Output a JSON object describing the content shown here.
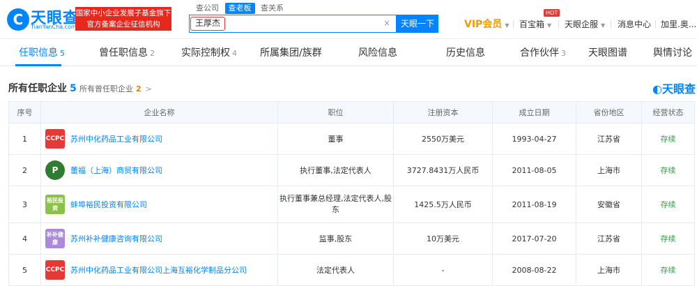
{
  "header": {
    "logo_mark": "C",
    "logo_title": "天眼查",
    "logo_sub": "TianYanCha.com",
    "banner_line1": "国家中小企业发展子基金旗下",
    "banner_line2": "官方备案企业征信机构",
    "search_tabs": [
      "查公司",
      "查老板",
      "查关系"
    ],
    "search_value": "王厚杰",
    "clear_glyph": "×",
    "search_button": "天眼一下",
    "vip": "VIP会员",
    "hot_badge": "HOT",
    "nav": [
      "百宝箱",
      "天眼企服",
      "消息中心",
      "加里.奥..."
    ]
  },
  "tabs": [
    {
      "label": "任职信息",
      "count": "5"
    },
    {
      "label": "曾任职信息",
      "count": "2"
    },
    {
      "label": "实际控制权",
      "count": "4"
    },
    {
      "label": "所属集团/族群",
      "count": ""
    },
    {
      "label": "风险信息",
      "count": ""
    },
    {
      "label": "历史信息",
      "count": ""
    },
    {
      "label": "合作伙伴",
      "count": "3"
    },
    {
      "label": "天眼图谱",
      "count": ""
    },
    {
      "label": "舆情讨论",
      "count": ""
    }
  ],
  "section": {
    "title": "所有任职企业",
    "count": "5",
    "sub_label": "所有曾任职企业",
    "sub_count": "2",
    "watermark": "天眼查"
  },
  "table": {
    "headers": [
      "序号",
      "企业名称",
      "职位",
      "注册资本",
      "成立日期",
      "省份地区",
      "经营状态"
    ],
    "rows": [
      {
        "idx": "1",
        "logo": "CCPC",
        "name": "苏州中化药品工业有限公司",
        "position": "董事",
        "capital": "2550万美元",
        "date": "1993-04-27",
        "region": "江苏省",
        "status": "存续"
      },
      {
        "idx": "2",
        "logo": "P",
        "name": "蕾福（上海）商贸有限公司",
        "position": "执行董事,法定代表人",
        "capital": "3727.8431万人民币",
        "date": "2011-08-05",
        "region": "上海市",
        "status": "存续"
      },
      {
        "idx": "3",
        "logo": "裕民投资",
        "name": "蚌埠裕民投资有限公司",
        "position": "执行董事兼总经理,法定代表人,股东",
        "capital": "1425.5万人民币",
        "date": "2011-08-19",
        "region": "安徽省",
        "status": "存续"
      },
      {
        "idx": "4",
        "logo": "补补健康",
        "name": "苏州补补健康咨询有限公司",
        "position": "监事,股东",
        "capital": "10万美元",
        "date": "2017-07-20",
        "region": "江苏省",
        "status": "存续"
      },
      {
        "idx": "5",
        "logo": "CCPC",
        "name": "苏州中化药品工业有限公司上海互裕化学制品分公司",
        "position": "法定代表人",
        "capital": "-",
        "date": "2008-08-22",
        "region": "上海市",
        "status": "存续"
      }
    ]
  }
}
